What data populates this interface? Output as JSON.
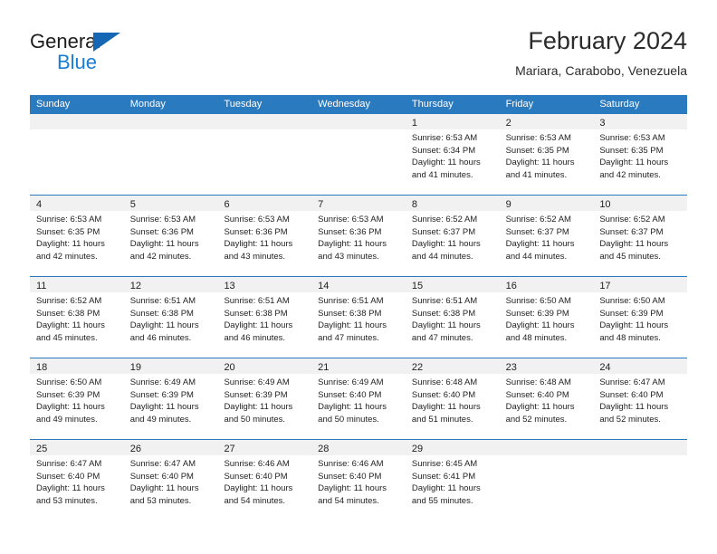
{
  "brand": {
    "name_top": "General",
    "name_bottom": "Blue",
    "accent_color": "#1b7dd1",
    "triangle_color": "#1567b5"
  },
  "header": {
    "title": "February 2024",
    "subtitle": "Mariara, Carabobo, Venezuela"
  },
  "calendar": {
    "header_bg": "#2a7ac0",
    "daynum_band_bg": "#f1f1f1",
    "weekdays": [
      "Sunday",
      "Monday",
      "Tuesday",
      "Wednesday",
      "Thursday",
      "Friday",
      "Saturday"
    ],
    "weeks": [
      [
        {
          "day": ""
        },
        {
          "day": ""
        },
        {
          "day": ""
        },
        {
          "day": ""
        },
        {
          "day": "1",
          "sunrise": "Sunrise: 6:53 AM",
          "sunset": "Sunset: 6:34 PM",
          "daylight": "Daylight: 11 hours and 41 minutes."
        },
        {
          "day": "2",
          "sunrise": "Sunrise: 6:53 AM",
          "sunset": "Sunset: 6:35 PM",
          "daylight": "Daylight: 11 hours and 41 minutes."
        },
        {
          "day": "3",
          "sunrise": "Sunrise: 6:53 AM",
          "sunset": "Sunset: 6:35 PM",
          "daylight": "Daylight: 11 hours and 42 minutes."
        }
      ],
      [
        {
          "day": "4",
          "sunrise": "Sunrise: 6:53 AM",
          "sunset": "Sunset: 6:35 PM",
          "daylight": "Daylight: 11 hours and 42 minutes."
        },
        {
          "day": "5",
          "sunrise": "Sunrise: 6:53 AM",
          "sunset": "Sunset: 6:36 PM",
          "daylight": "Daylight: 11 hours and 42 minutes."
        },
        {
          "day": "6",
          "sunrise": "Sunrise: 6:53 AM",
          "sunset": "Sunset: 6:36 PM",
          "daylight": "Daylight: 11 hours and 43 minutes."
        },
        {
          "day": "7",
          "sunrise": "Sunrise: 6:53 AM",
          "sunset": "Sunset: 6:36 PM",
          "daylight": "Daylight: 11 hours and 43 minutes."
        },
        {
          "day": "8",
          "sunrise": "Sunrise: 6:52 AM",
          "sunset": "Sunset: 6:37 PM",
          "daylight": "Daylight: 11 hours and 44 minutes."
        },
        {
          "day": "9",
          "sunrise": "Sunrise: 6:52 AM",
          "sunset": "Sunset: 6:37 PM",
          "daylight": "Daylight: 11 hours and 44 minutes."
        },
        {
          "day": "10",
          "sunrise": "Sunrise: 6:52 AM",
          "sunset": "Sunset: 6:37 PM",
          "daylight": "Daylight: 11 hours and 45 minutes."
        }
      ],
      [
        {
          "day": "11",
          "sunrise": "Sunrise: 6:52 AM",
          "sunset": "Sunset: 6:38 PM",
          "daylight": "Daylight: 11 hours and 45 minutes."
        },
        {
          "day": "12",
          "sunrise": "Sunrise: 6:51 AM",
          "sunset": "Sunset: 6:38 PM",
          "daylight": "Daylight: 11 hours and 46 minutes."
        },
        {
          "day": "13",
          "sunrise": "Sunrise: 6:51 AM",
          "sunset": "Sunset: 6:38 PM",
          "daylight": "Daylight: 11 hours and 46 minutes."
        },
        {
          "day": "14",
          "sunrise": "Sunrise: 6:51 AM",
          "sunset": "Sunset: 6:38 PM",
          "daylight": "Daylight: 11 hours and 47 minutes."
        },
        {
          "day": "15",
          "sunrise": "Sunrise: 6:51 AM",
          "sunset": "Sunset: 6:38 PM",
          "daylight": "Daylight: 11 hours and 47 minutes."
        },
        {
          "day": "16",
          "sunrise": "Sunrise: 6:50 AM",
          "sunset": "Sunset: 6:39 PM",
          "daylight": "Daylight: 11 hours and 48 minutes."
        },
        {
          "day": "17",
          "sunrise": "Sunrise: 6:50 AM",
          "sunset": "Sunset: 6:39 PM",
          "daylight": "Daylight: 11 hours and 48 minutes."
        }
      ],
      [
        {
          "day": "18",
          "sunrise": "Sunrise: 6:50 AM",
          "sunset": "Sunset: 6:39 PM",
          "daylight": "Daylight: 11 hours and 49 minutes."
        },
        {
          "day": "19",
          "sunrise": "Sunrise: 6:49 AM",
          "sunset": "Sunset: 6:39 PM",
          "daylight": "Daylight: 11 hours and 49 minutes."
        },
        {
          "day": "20",
          "sunrise": "Sunrise: 6:49 AM",
          "sunset": "Sunset: 6:39 PM",
          "daylight": "Daylight: 11 hours and 50 minutes."
        },
        {
          "day": "21",
          "sunrise": "Sunrise: 6:49 AM",
          "sunset": "Sunset: 6:40 PM",
          "daylight": "Daylight: 11 hours and 50 minutes."
        },
        {
          "day": "22",
          "sunrise": "Sunrise: 6:48 AM",
          "sunset": "Sunset: 6:40 PM",
          "daylight": "Daylight: 11 hours and 51 minutes."
        },
        {
          "day": "23",
          "sunrise": "Sunrise: 6:48 AM",
          "sunset": "Sunset: 6:40 PM",
          "daylight": "Daylight: 11 hours and 52 minutes."
        },
        {
          "day": "24",
          "sunrise": "Sunrise: 6:47 AM",
          "sunset": "Sunset: 6:40 PM",
          "daylight": "Daylight: 11 hours and 52 minutes."
        }
      ],
      [
        {
          "day": "25",
          "sunrise": "Sunrise: 6:47 AM",
          "sunset": "Sunset: 6:40 PM",
          "daylight": "Daylight: 11 hours and 53 minutes."
        },
        {
          "day": "26",
          "sunrise": "Sunrise: 6:47 AM",
          "sunset": "Sunset: 6:40 PM",
          "daylight": "Daylight: 11 hours and 53 minutes."
        },
        {
          "day": "27",
          "sunrise": "Sunrise: 6:46 AM",
          "sunset": "Sunset: 6:40 PM",
          "daylight": "Daylight: 11 hours and 54 minutes."
        },
        {
          "day": "28",
          "sunrise": "Sunrise: 6:46 AM",
          "sunset": "Sunset: 6:40 PM",
          "daylight": "Daylight: 11 hours and 54 minutes."
        },
        {
          "day": "29",
          "sunrise": "Sunrise: 6:45 AM",
          "sunset": "Sunset: 6:41 PM",
          "daylight": "Daylight: 11 hours and 55 minutes."
        },
        {
          "day": ""
        },
        {
          "day": ""
        }
      ]
    ]
  }
}
